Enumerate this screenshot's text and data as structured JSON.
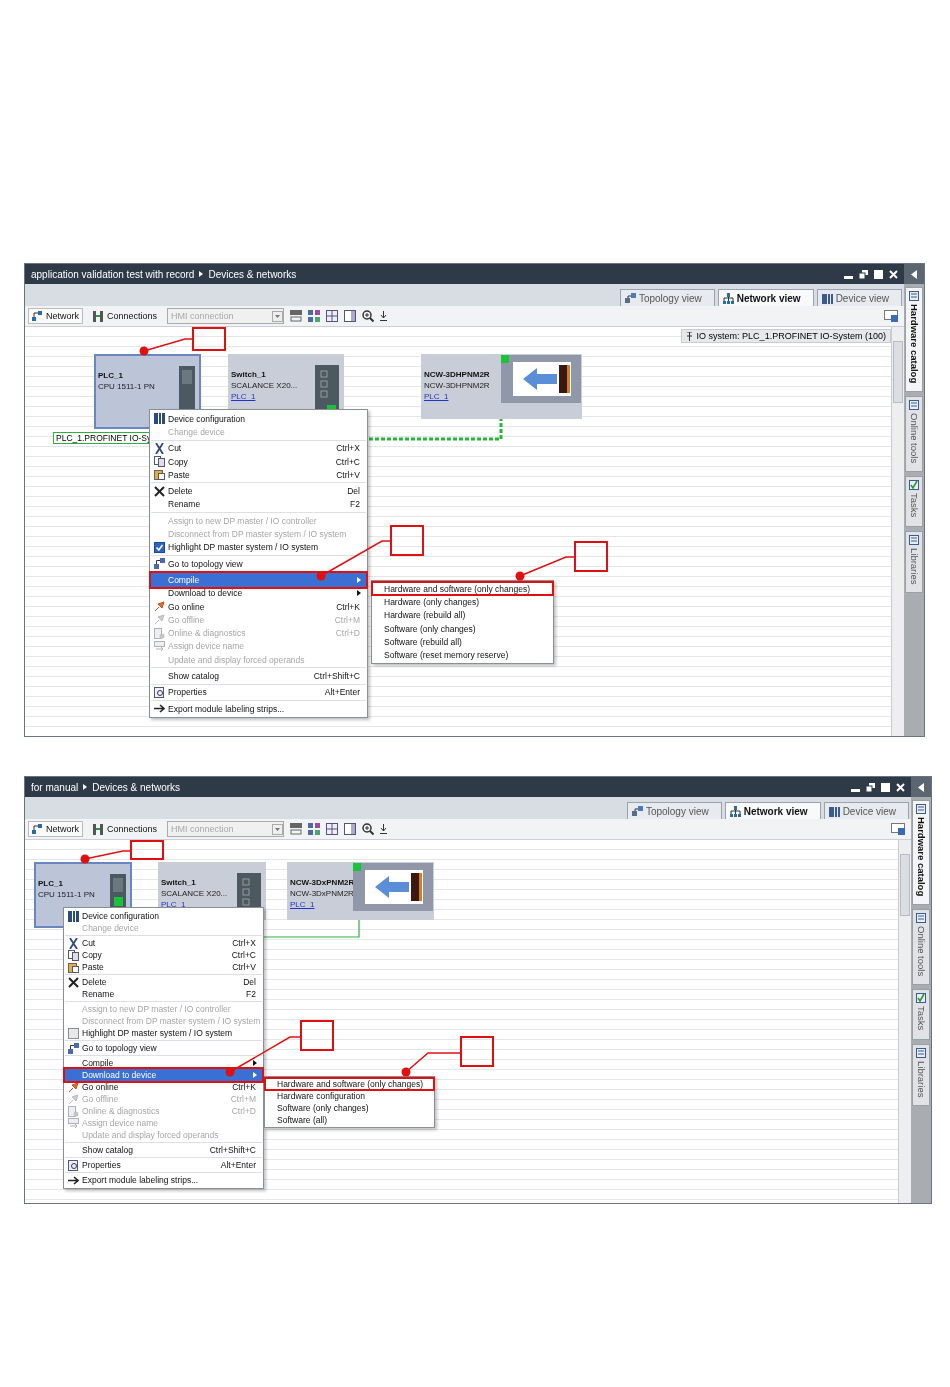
{
  "windows": [
    {
      "breadcrumb": [
        "application validation test with record",
        "Devices & networks"
      ],
      "view_tabs": [
        {
          "label": "Topology view",
          "selected": false
        },
        {
          "label": "Network view",
          "selected": true
        },
        {
          "label": "Device view",
          "selected": false
        }
      ],
      "toolbar": {
        "network": "Network",
        "connections": "Connections",
        "connection_field": {
          "value": "HMI connection",
          "disabled": true
        }
      },
      "io_system": "IO system: PLC_1.PROFINET IO-System (100)",
      "devices": [
        {
          "kind": "cpu",
          "name": "PLC_1",
          "type": "CPU 1511-1 PN",
          "selected": true
        },
        {
          "kind": "switch",
          "name": "Switch_1",
          "type": "SCALANCE X20...",
          "link": "PLC_1",
          "selected": false
        },
        {
          "kind": "drive",
          "name": "NCW-3DHPNM2R",
          "type": "NCW-3DHPNM2R",
          "link": "PLC_1",
          "selected": false
        }
      ],
      "network_label": "PLC_1.PROFINET IO-Sy",
      "context_menu": {
        "groups": [
          [
            {
              "kind": "command",
              "label": "Device configuration",
              "disabled": false,
              "selected": false
            },
            {
              "kind": "command",
              "label": "Change device",
              "disabled": true,
              "selected": false
            }
          ],
          [
            {
              "kind": "command",
              "label": "Cut",
              "shortcut": "Ctrl+X",
              "disabled": false,
              "selected": false
            },
            {
              "kind": "command",
              "label": "Copy",
              "shortcut": "Ctrl+C",
              "disabled": false,
              "selected": false
            },
            {
              "kind": "command",
              "label": "Paste",
              "shortcut": "Ctrl+V",
              "disabled": false,
              "selected": false
            }
          ],
          [
            {
              "kind": "command",
              "label": "Delete",
              "shortcut": "Del",
              "disabled": false,
              "selected": false
            },
            {
              "kind": "command",
              "label": "Rename",
              "shortcut": "F2",
              "disabled": false,
              "selected": false
            }
          ],
          [
            {
              "kind": "command",
              "label": "Assign to new DP master / IO controller",
              "disabled": true,
              "selected": false
            },
            {
              "kind": "command",
              "label": "Disconnect from DP master system / IO system",
              "disabled": true,
              "selected": false
            },
            {
              "kind": "checkbox",
              "label": "Highlight DP master system / IO system",
              "checked": true,
              "disabled": false,
              "selected": false
            }
          ],
          [
            {
              "kind": "command",
              "label": "Go to topology view",
              "disabled": false,
              "selected": false
            }
          ],
          [
            {
              "kind": "submenu",
              "label": "Compile",
              "disabled": false,
              "selected": true
            },
            {
              "kind": "submenu",
              "label": "Download to device",
              "disabled": false,
              "selected": false
            },
            {
              "kind": "command",
              "label": "Go online",
              "shortcut": "Ctrl+K",
              "disabled": false,
              "selected": false
            },
            {
              "kind": "command",
              "label": "Go offline",
              "shortcut": "Ctrl+M",
              "disabled": true,
              "selected": false
            },
            {
              "kind": "command",
              "label": "Online & diagnostics",
              "shortcut": "Ctrl+D",
              "disabled": true,
              "selected": false
            },
            {
              "kind": "command",
              "label": "Assign device name",
              "disabled": true,
              "selected": false
            },
            {
              "kind": "command",
              "label": "Update and display forced operands",
              "disabled": true,
              "selected": false
            }
          ],
          [
            {
              "kind": "command",
              "label": "Show catalog",
              "shortcut": "Ctrl+Shift+C",
              "disabled": false,
              "selected": false
            }
          ],
          [
            {
              "kind": "command",
              "label": "Properties",
              "shortcut": "Alt+Enter",
              "disabled": false,
              "selected": false
            }
          ],
          [
            {
              "kind": "command",
              "label": "Export module labeling strips...",
              "disabled": false,
              "selected": false
            }
          ]
        ]
      },
      "submenu": [
        {
          "label": "Hardware and software (only changes)",
          "framed": true
        },
        {
          "label": "Hardware (only changes)",
          "framed": false
        },
        {
          "label": "Hardware (rebuild all)",
          "framed": false
        },
        {
          "label": "Software (only changes)",
          "framed": false
        },
        {
          "label": "Software (rebuild all)",
          "framed": false
        },
        {
          "label": "Software (reset memory reserve)",
          "framed": false
        }
      ],
      "side_tabs": [
        {
          "label": "Hardware catalog",
          "selected": true
        },
        {
          "label": "Online tools",
          "selected": false
        },
        {
          "label": "Tasks",
          "selected": false
        },
        {
          "label": "Libraries",
          "selected": false
        }
      ]
    },
    {
      "breadcrumb": [
        "for manual",
        "Devices & networks"
      ],
      "view_tabs": [
        {
          "label": "Topology view",
          "selected": false
        },
        {
          "label": "Network view",
          "selected": true
        },
        {
          "label": "Device view",
          "selected": false
        }
      ],
      "toolbar": {
        "network": "Network",
        "connections": "Connections",
        "connection_field": {
          "value": "HMI connection",
          "disabled": true
        }
      },
      "devices": [
        {
          "kind": "cpu",
          "name": "PLC_1",
          "type": "CPU 1511-1 PN",
          "selected": true
        },
        {
          "kind": "switch",
          "name": "Switch_1",
          "type": "SCALANCE X20...",
          "link": "PLC_1",
          "selected": false
        },
        {
          "kind": "drive",
          "name": "NCW-3DxPNM2R",
          "type": "NCW-3DxPNM2R",
          "link": "PLC_1",
          "selected": false
        }
      ],
      "context_menu": {
        "groups": [
          [
            {
              "kind": "command",
              "label": "Device configuration",
              "disabled": false,
              "selected": false
            },
            {
              "kind": "command",
              "label": "Change device",
              "disabled": true,
              "selected": false
            }
          ],
          [
            {
              "kind": "command",
              "label": "Cut",
              "shortcut": "Ctrl+X",
              "disabled": false,
              "selected": false
            },
            {
              "kind": "command",
              "label": "Copy",
              "shortcut": "Ctrl+C",
              "disabled": false,
              "selected": false
            },
            {
              "kind": "command",
              "label": "Paste",
              "shortcut": "Ctrl+V",
              "disabled": false,
              "selected": false
            }
          ],
          [
            {
              "kind": "command",
              "label": "Delete",
              "shortcut": "Del",
              "disabled": false,
              "selected": false
            },
            {
              "kind": "command",
              "label": "Rename",
              "shortcut": "F2",
              "disabled": false,
              "selected": false
            }
          ],
          [
            {
              "kind": "command",
              "label": "Assign to new DP master / IO controller",
              "disabled": true,
              "selected": false
            },
            {
              "kind": "command",
              "label": "Disconnect from DP master system / IO system",
              "disabled": true,
              "selected": false
            },
            {
              "kind": "checkbox",
              "label": "Highlight DP master system / IO system",
              "checked": false,
              "disabled": false,
              "selected": false
            }
          ],
          [
            {
              "kind": "command",
              "label": "Go to topology view",
              "disabled": false,
              "selected": false
            }
          ],
          [
            {
              "kind": "submenu",
              "label": "Compile",
              "disabled": false,
              "selected": false
            },
            {
              "kind": "submenu",
              "label": "Download to device",
              "disabled": false,
              "selected": true
            },
            {
              "kind": "command",
              "label": "Go online",
              "shortcut": "Ctrl+K",
              "disabled": false,
              "selected": false
            },
            {
              "kind": "command",
              "label": "Go offline",
              "shortcut": "Ctrl+M",
              "disabled": true,
              "selected": false
            },
            {
              "kind": "command",
              "label": "Online & diagnostics",
              "shortcut": "Ctrl+D",
              "disabled": true,
              "selected": false
            },
            {
              "kind": "command",
              "label": "Assign device name",
              "disabled": true,
              "selected": false
            },
            {
              "kind": "command",
              "label": "Update and display forced operands",
              "disabled": true,
              "selected": false
            }
          ],
          [
            {
              "kind": "command",
              "label": "Show catalog",
              "shortcut": "Ctrl+Shift+C",
              "disabled": false,
              "selected": false
            }
          ],
          [
            {
              "kind": "command",
              "label": "Properties",
              "shortcut": "Alt+Enter",
              "disabled": false,
              "selected": false
            }
          ],
          [
            {
              "kind": "command",
              "label": "Export module labeling strips...",
              "disabled": false,
              "selected": false
            }
          ]
        ]
      },
      "submenu": [
        {
          "label": "Hardware and software (only changes)",
          "framed": true
        },
        {
          "label": "Hardware configuration",
          "framed": false
        },
        {
          "label": "Software (only changes)",
          "framed": false
        },
        {
          "label": "Software (all)",
          "framed": false
        }
      ],
      "side_tabs": [
        {
          "label": "Hardware catalog",
          "selected": true
        },
        {
          "label": "Online tools",
          "selected": false
        },
        {
          "label": "Tasks",
          "selected": false
        },
        {
          "label": "Libraries",
          "selected": false
        }
      ]
    }
  ]
}
